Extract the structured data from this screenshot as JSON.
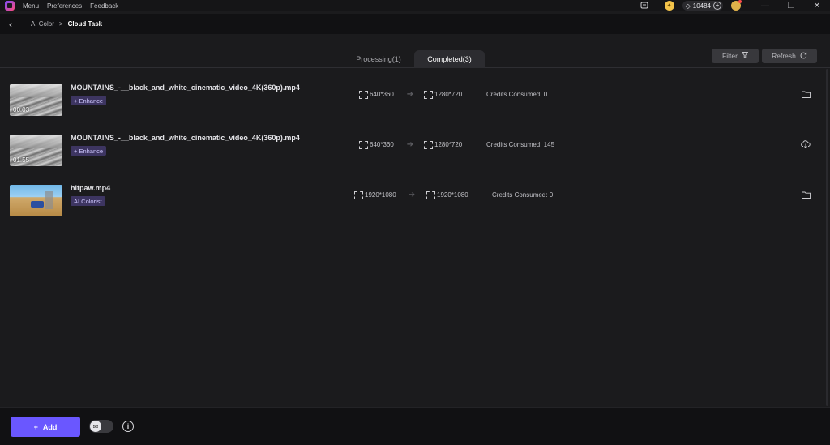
{
  "titlebar": {
    "menu": [
      "Menu",
      "Preferences",
      "Feedback"
    ],
    "credits": "10484",
    "icons": [
      "app-logo-icon",
      "chat-icon",
      "coin-icon",
      "diamond-icon",
      "plus-icon",
      "avatar-icon",
      "minimize-icon",
      "restore-icon",
      "close-icon"
    ]
  },
  "breadcrumb": {
    "parent": "AI Color",
    "separator": ">",
    "current": "Cloud Task"
  },
  "tabs": [
    {
      "label": "Processing(1)",
      "active": false
    },
    {
      "label": "Completed(3)",
      "active": true
    }
  ],
  "toolbar": {
    "filter_label": "Filter",
    "refresh_label": "Refresh"
  },
  "tasks": [
    {
      "name": "MOUNTAINS_-__black_and_white_cinematic_video_4K(360p).mp4",
      "duration": "00:03",
      "badge": "+ Enhance",
      "from_res": "640*360",
      "to_res": "1280*720",
      "credits": "Credits Consumed: 0",
      "action_icon": "folder-icon"
    },
    {
      "name": "MOUNTAINS_-__black_and_white_cinematic_video_4K(360p).mp4",
      "duration": "01:55",
      "badge": "+ Enhance",
      "from_res": "640*360",
      "to_res": "1280*720",
      "credits": "Credits Consumed: 145",
      "action_icon": "cloud-download-icon"
    },
    {
      "name": "hitpaw.mp4",
      "duration": "",
      "badge": "AI Colorist",
      "from_res": "1920*1080",
      "to_res": "1920*1080",
      "credits": "Credits Consumed: 0",
      "action_icon": "folder-icon"
    }
  ],
  "bottom": {
    "add_label": "Add"
  },
  "colors": {
    "accent": "#6a57ff",
    "badge_bg": "#3d3561",
    "background": "#1b1b1d"
  }
}
